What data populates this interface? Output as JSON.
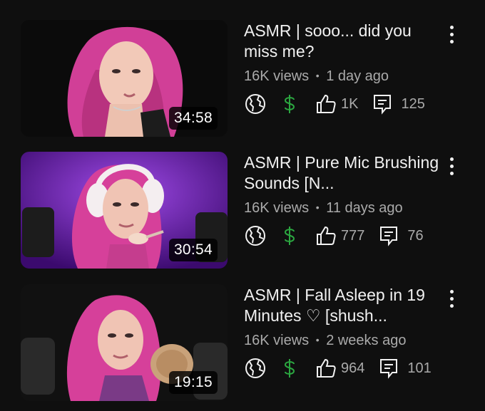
{
  "videos": [
    {
      "title": "ASMR | sooo... did you miss me?",
      "views": "16K views",
      "separator": "•",
      "age": "1 day ago",
      "duration": "34:58",
      "visibility_icon": "globe-icon",
      "monetization_icon": "dollar-icon",
      "likes": "1K",
      "comments": "125",
      "thumb_bg": "#0a0a0a"
    },
    {
      "title": "ASMR | Pure Mic Brushing Sounds [N...",
      "views": "16K views",
      "separator": "•",
      "age": "11 days ago",
      "duration": "30:54",
      "visibility_icon": "globe-icon",
      "monetization_icon": "dollar-icon",
      "likes": "777",
      "comments": "76",
      "thumb_bg": "#6a1bb0"
    },
    {
      "title": "ASMR | Fall Asleep in 19 Minutes ♡ [shush...",
      "views": "16K views",
      "separator": "•",
      "age": "2 weeks ago",
      "duration": "19:15",
      "visibility_icon": "globe-icon",
      "monetization_icon": "dollar-icon",
      "likes": "964",
      "comments": "101",
      "thumb_bg": "#141414"
    }
  ],
  "colors": {
    "background": "#0f0f0f",
    "text_primary": "#f1f1f1",
    "text_secondary": "#aaaaaa",
    "monetized_green": "#2ba640",
    "hair_pink": "#e0479e"
  }
}
